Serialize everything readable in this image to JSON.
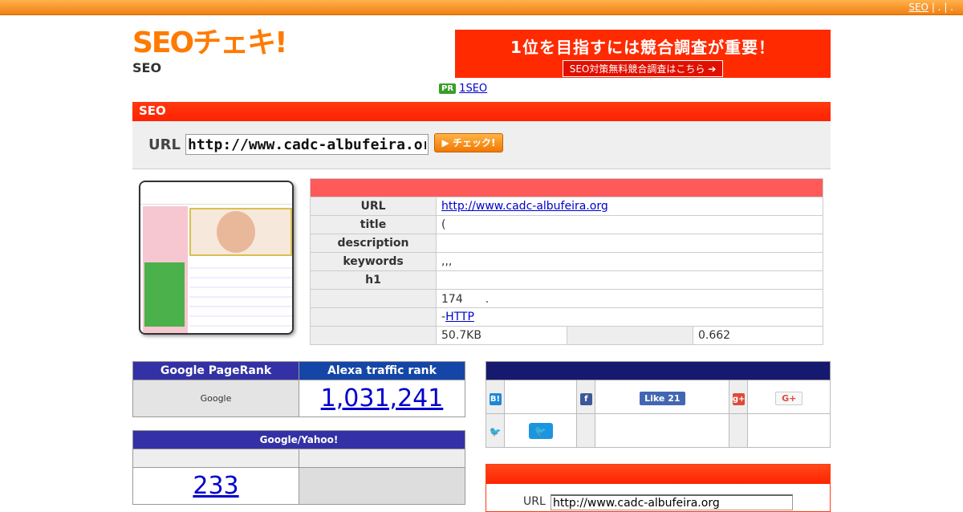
{
  "topbar": {
    "link1": "SEO",
    "sep": " | . | ."
  },
  "header": {
    "logo_text": "SEOチェキ!",
    "logo_sub": "SEO",
    "banner_title": "1位を目指すには競合調査が重要！",
    "banner_button": "SEO対策無料競合調査はこちら ➔",
    "pr_badge": "PR",
    "pr_link": "1SEO"
  },
  "seo_section": {
    "title": "SEO",
    "url_label": "URL",
    "url_value": "http://www.cadc-albufeira.org",
    "check_label": "▶ チェック!"
  },
  "info": {
    "rows": [
      {
        "key": "URL",
        "value": "http://www.cadc-albufeira.org"
      },
      {
        "key": "title",
        "value": "("
      },
      {
        "key": "description",
        "value": ""
      },
      {
        "key": "keywords",
        "value": ",,,"
      },
      {
        "key": "h1",
        "value": ""
      },
      {
        "key": "",
        "value": "174　　."
      },
      {
        "key": "",
        "value_prefix": "-",
        "value_link": "HTTP"
      }
    ],
    "size_value": "50.7KB",
    "time_value": "0.662"
  },
  "pagerank": {
    "google_header": "Google PageRank",
    "alexa_header": "Alexa traffic rank",
    "google_value": "Google",
    "alexa_value": "1,031,241"
  },
  "index": {
    "header": "Google/Yahoo!",
    "google_value": "233"
  },
  "social": {
    "fb_like": "Like 21",
    "gplus": "G+",
    "hatena_icon": "B!",
    "fb_icon": "f",
    "gplus_icon": "g+",
    "twitter_icon": "🐦"
  },
  "bottom": {
    "url_label": "URL",
    "url_value": "http://www.cadc-albufeira.org"
  },
  "colors": {
    "accent": "#ff2a00",
    "orange": "#ff7a00",
    "navy": "#3331a5"
  }
}
